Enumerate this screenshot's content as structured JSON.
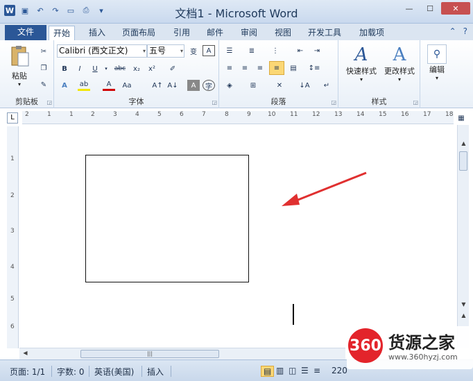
{
  "window": {
    "title": "文档1 - Microsoft Word",
    "app_icon": "W",
    "controls": [
      "—",
      "☐",
      "✕"
    ]
  },
  "quick_access": [
    "save-icon",
    "undo-icon",
    "redo-icon",
    "open-icon",
    "print-preview-icon",
    "customize-icon"
  ],
  "tabs": {
    "file": "文件",
    "items": [
      "开始",
      "插入",
      "页面布局",
      "引用",
      "邮件",
      "审阅",
      "视图",
      "开发工具",
      "加载项"
    ],
    "active": "开始"
  },
  "ribbon": {
    "clipboard": {
      "label": "剪贴板",
      "paste": "粘贴"
    },
    "font": {
      "label": "字体",
      "font_name": "Calibri (西文正文)",
      "font_size": "五号"
    },
    "paragraph": {
      "label": "段落"
    },
    "styles": {
      "label": "样式",
      "quick_styles": "快速样式",
      "change_styles": "更改样式"
    },
    "editing": {
      "label": "编辑",
      "edit": "编辑"
    }
  },
  "ruler": {
    "h_ticks": [
      "2",
      "1",
      "",
      "1",
      "2",
      "3",
      "4",
      "5",
      "6",
      "7",
      "8",
      "9",
      "10",
      "11",
      "12",
      "13",
      "14",
      "15",
      "16",
      "17",
      "18"
    ],
    "v_ticks": [
      "1",
      "2",
      "3",
      "4",
      "5",
      "6"
    ]
  },
  "status": {
    "page": "页面: 1/1",
    "words": "字数: 0",
    "language": "英语(美国)",
    "mode": "插入",
    "zoom": "220"
  },
  "watermark": {
    "badge": "360",
    "name": "货源之家",
    "url": "www.360hyzj.com"
  },
  "colors": {
    "accent": "#2b5797",
    "arrow": "#e03030",
    "watermark": "#e3242b"
  }
}
